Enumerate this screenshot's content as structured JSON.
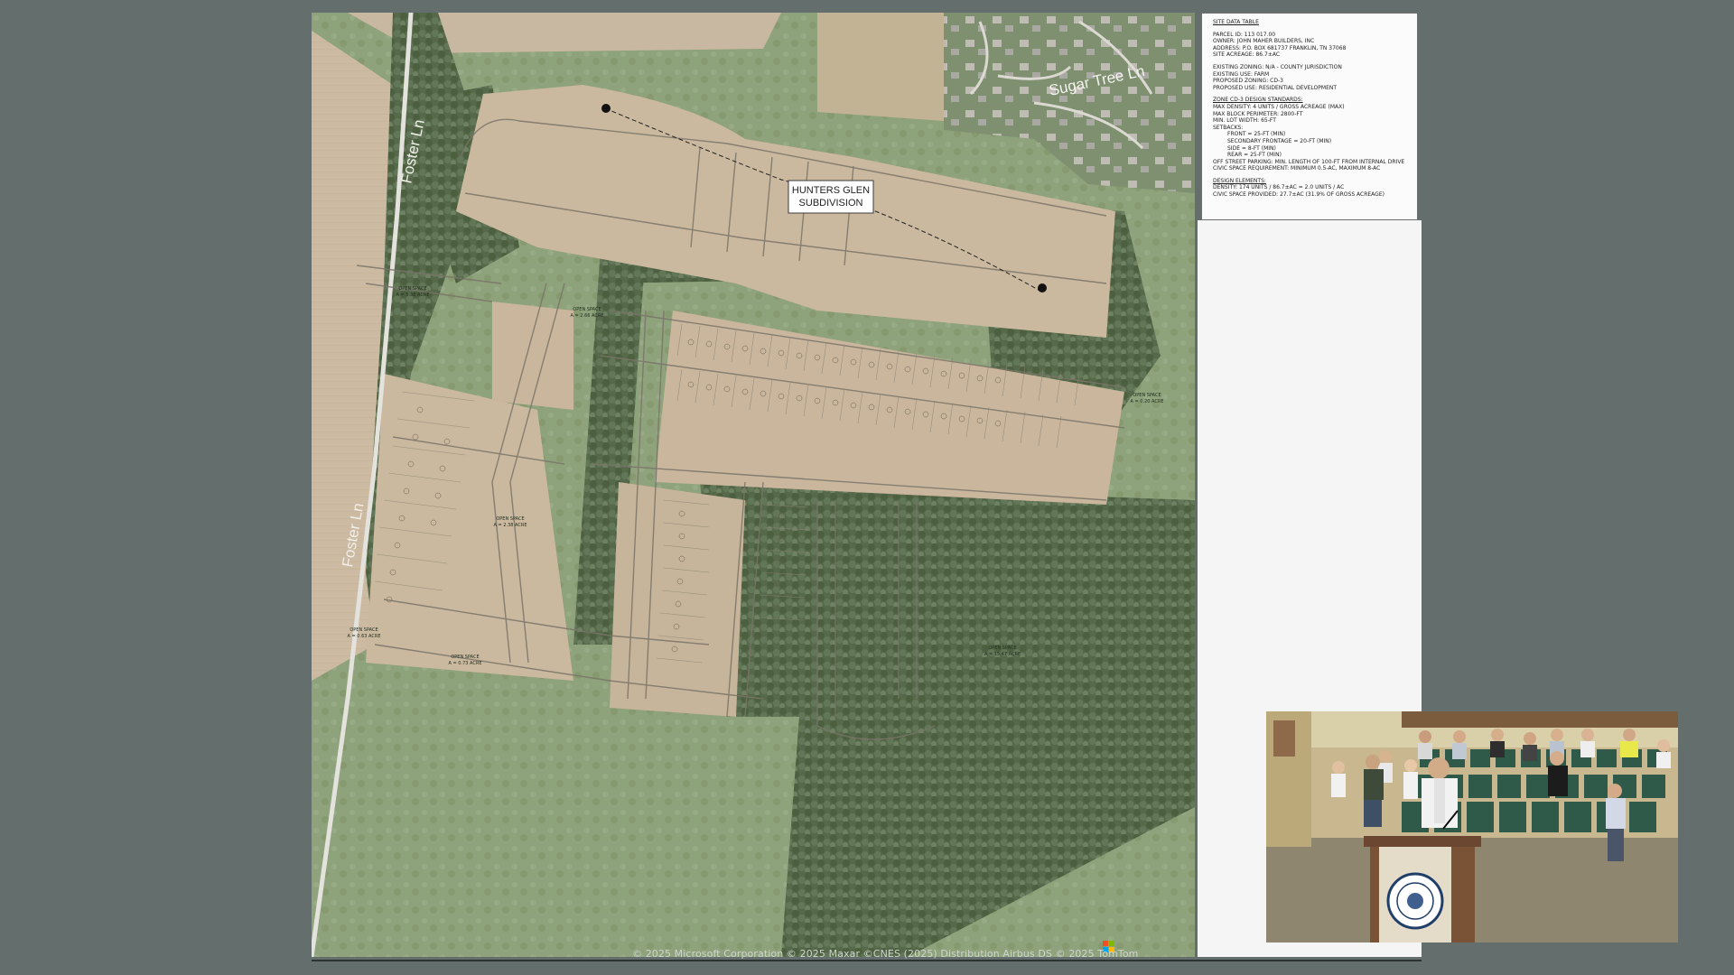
{
  "map": {
    "subdivision_label": [
      "HUNTERS GLEN",
      "SUBDIVISION"
    ],
    "road_labels": {
      "foster_north": "Foster Ln",
      "foster_south": "Foster Ln",
      "sugar_tree": "Sugar Tree Ln"
    },
    "open_space_labels": {
      "os1": [
        "OPEN SPACE",
        "A = 5.38 ACRE"
      ],
      "os2": [
        "OPEN SPACE",
        "A = 2.66 ACRE"
      ],
      "os3": [
        "OPEN SPACE",
        "A = 2.38 ACRE"
      ],
      "os4": [
        "OPEN SPACE",
        "A = 0.63 ACRE"
      ],
      "os5": [
        "OPEN SPACE",
        "A = 0.73 ACRE"
      ],
      "os6": [
        "OPEN SPACE",
        "A = 15.47 ACRE"
      ],
      "os7": [
        "OPEN SPACE",
        "A = 0.20 ACRE"
      ]
    },
    "attribution": "© 2025 Microsoft Corporation © 2025 Maxar ©CNES (2025) Distribution Airbus DS © 2025 TomTom"
  },
  "site_data_table": {
    "title": "SITE DATA TABLE",
    "block1": [
      "PARCEL ID: 113 017.00",
      "OWNER: JOHN MAHER BUILDERS, INC",
      "ADDRESS: P.O. BOX 681737 FRANKLIN, TN 37068",
      "SITE ACREAGE: 86.7±AC"
    ],
    "block2": [
      "EXISTING ZONING: N/A - COUNTY JURISDICTION",
      "EXISTING USE: FARM",
      "PROPOSED ZONING: CD-3",
      "PROPOSED USE: RESIDENTIAL DEVELOPMENT"
    ],
    "standards_title": "ZONE CD-3 DESIGN STANDARDS:",
    "standards": [
      "MAX DENSITY: 4 UNITS / GROSS ACREAGE (MAX)",
      "MAX BLOCK PERIMETER: 2800-FT",
      "MIN. LOT WIDTH: 65-FT",
      "SETBACKS:"
    ],
    "setbacks": [
      "FRONT = 25-FT (MIN)",
      "SECONDARY FRONTAGE = 20-FT (MIN)",
      "SIDE = 8-FT (MIN)",
      "REAR = 25-FT (MIN)"
    ],
    "standards_tail": [
      "OFF STREET PARKING: MIN. LENGTH OF 100-FT FROM INTERNAL DRIVE",
      "CIVIC SPACE REQUIREMENT: MINIMUM 0.5-AC, MAXIMUM 8-AC"
    ],
    "elements_title": "DESIGN ELEMENTS:",
    "elements": [
      "DENSITY: 174 UNITS / 86.7±AC = 2.0 UNITS / AC",
      "CIVIC SPACE PROVIDED: 27.7±AC (31.9% OF GROSS ACREAGE)"
    ]
  },
  "camera_feed": {
    "seal_text": "CITY OF COLUMBIA TENNESSEE"
  },
  "colors": {
    "background": "#646e6c",
    "field": "#cbb9a0",
    "forest": "#55684a",
    "grass": "#8fa77d"
  }
}
